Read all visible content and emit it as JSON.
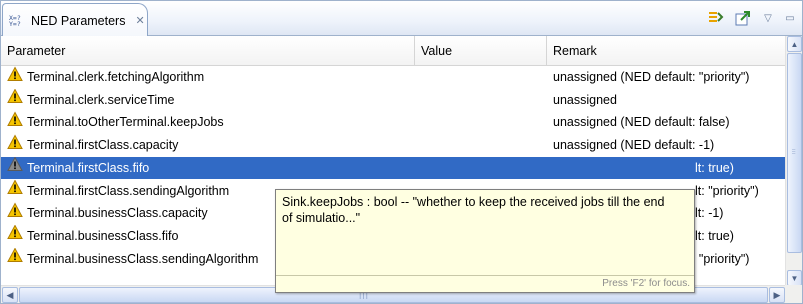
{
  "view": {
    "tab_icon_text": "X=?\nY=?",
    "title": "NED Parameters",
    "close_symbol": "✕",
    "menu_symbol": "▽",
    "minimize_symbol": "▭"
  },
  "table": {
    "columns": [
      "Parameter",
      "Value",
      "Remark"
    ],
    "rows": [
      {
        "parameter": "Terminal.clerk.fetchingAlgorithm",
        "value": "",
        "remark": "unassigned (NED default: \"priority\")"
      },
      {
        "parameter": "Terminal.clerk.serviceTime",
        "value": "",
        "remark": "unassigned"
      },
      {
        "parameter": "Terminal.toOtherTerminal.keepJobs",
        "value": "",
        "remark": "unassigned (NED default: false)"
      },
      {
        "parameter": "Terminal.firstClass.capacity",
        "value": "",
        "remark": "unassigned (NED default: -1)"
      },
      {
        "parameter": "Terminal.firstClass.fifo",
        "value": "",
        "remark": "lt: true)",
        "selected": true
      },
      {
        "parameter": "Terminal.firstClass.sendingAlgorithm",
        "value": "",
        "remark": "lt: \"priority\")"
      },
      {
        "parameter": "Terminal.businessClass.capacity",
        "value": "",
        "remark": "lt: -1)"
      },
      {
        "parameter": "Terminal.businessClass.fifo",
        "value": "",
        "remark": "lt: true)"
      },
      {
        "parameter": "Terminal.businessClass.sendingAlgorithm",
        "value": "",
        "remark": "unassigned (NED default: \"priority\")"
      }
    ]
  },
  "tooltip": {
    "text": "Sink.keepJobs : bool -- \"whether to keep the received jobs till the end of simulatio...\"",
    "hint": "Press 'F2' for focus."
  },
  "colors": {
    "selection": "#316ac5",
    "tooltip_bg": "#ffffe1",
    "warning": "#f5c400"
  },
  "icons": {
    "row": "warning-icon",
    "toolbar_1": "edit-parameters-icon",
    "toolbar_2": "open-in-editor-icon"
  }
}
